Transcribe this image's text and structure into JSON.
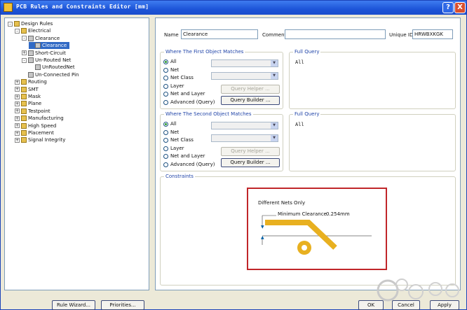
{
  "window": {
    "title": "PCB Rules and Constraints Editor [mm]",
    "help": "?",
    "close": "X"
  },
  "tree": [
    {
      "label": "Design Rules",
      "depth": 0,
      "exp": "-",
      "icon": "folder"
    },
    {
      "label": "Electrical",
      "depth": 1,
      "exp": "-",
      "icon": "folder"
    },
    {
      "label": "Clearance",
      "depth": 2,
      "exp": "-",
      "icon": "rule"
    },
    {
      "label": "Clearance",
      "depth": 3,
      "exp": "",
      "icon": "rule",
      "selected": true
    },
    {
      "label": "Short-Circuit",
      "depth": 2,
      "exp": "+",
      "icon": "rule"
    },
    {
      "label": "Un-Routed Net",
      "depth": 2,
      "exp": "-",
      "icon": "rule"
    },
    {
      "label": "UnRoutedNet",
      "depth": 3,
      "exp": "",
      "icon": "rule"
    },
    {
      "label": "Un-Connected Pin",
      "depth": 2,
      "exp": "",
      "icon": "rule"
    },
    {
      "label": "Routing",
      "depth": 1,
      "exp": "+",
      "icon": "folder"
    },
    {
      "label": "SMT",
      "depth": 1,
      "exp": "+",
      "icon": "folder"
    },
    {
      "label": "Mask",
      "depth": 1,
      "exp": "+",
      "icon": "folder"
    },
    {
      "label": "Plane",
      "depth": 1,
      "exp": "+",
      "icon": "folder"
    },
    {
      "label": "Testpoint",
      "depth": 1,
      "exp": "+",
      "icon": "folder"
    },
    {
      "label": "Manufacturing",
      "depth": 1,
      "exp": "+",
      "icon": "folder"
    },
    {
      "label": "High Speed",
      "depth": 1,
      "exp": "+",
      "icon": "folder"
    },
    {
      "label": "Placement",
      "depth": 1,
      "exp": "+",
      "icon": "folder"
    },
    {
      "label": "Signal Integrity",
      "depth": 1,
      "exp": "+",
      "icon": "folder"
    }
  ],
  "form": {
    "name_label": "Name",
    "name_value": "Clearance",
    "comment_label": "Comment",
    "comment_value": "",
    "uid_label": "Unique ID",
    "uid_value": "HRWBXKGK"
  },
  "first_match": {
    "title": "Where The First Object Matches",
    "options": [
      "All",
      "Net",
      "Net Class",
      "Layer",
      "Net and Layer",
      "Advanced (Query)"
    ],
    "selected": 0,
    "query_helper": "Query Helper ...",
    "query_builder": "Query Builder ...",
    "full_query_title": "Full Query",
    "full_query": "All"
  },
  "second_match": {
    "title": "Where The Second Object Matches",
    "options": [
      "All",
      "Net",
      "Net Class",
      "Layer",
      "Net and Layer",
      "Advanced (Query)"
    ],
    "selected": 0,
    "query_helper": "Query Helper ...",
    "query_builder": "Query Builder ...",
    "full_query_title": "Full Query",
    "full_query": "All"
  },
  "constraints": {
    "title": "Constraints",
    "nets_label": "Different Nets Only",
    "min_clearance_label": "Minimum Clearance",
    "min_clearance_value": "0.254mm"
  },
  "buttons": {
    "rule_wizard": "Rule Wizard...",
    "priorities": "Priorities...",
    "ok": "OK",
    "cancel": "Cancel",
    "apply": "Apply"
  },
  "colors": {
    "selection": "#316ac5",
    "trace": "#e8b020",
    "highlight_box": "#c0262a",
    "title_bar": "#1d55d8"
  }
}
